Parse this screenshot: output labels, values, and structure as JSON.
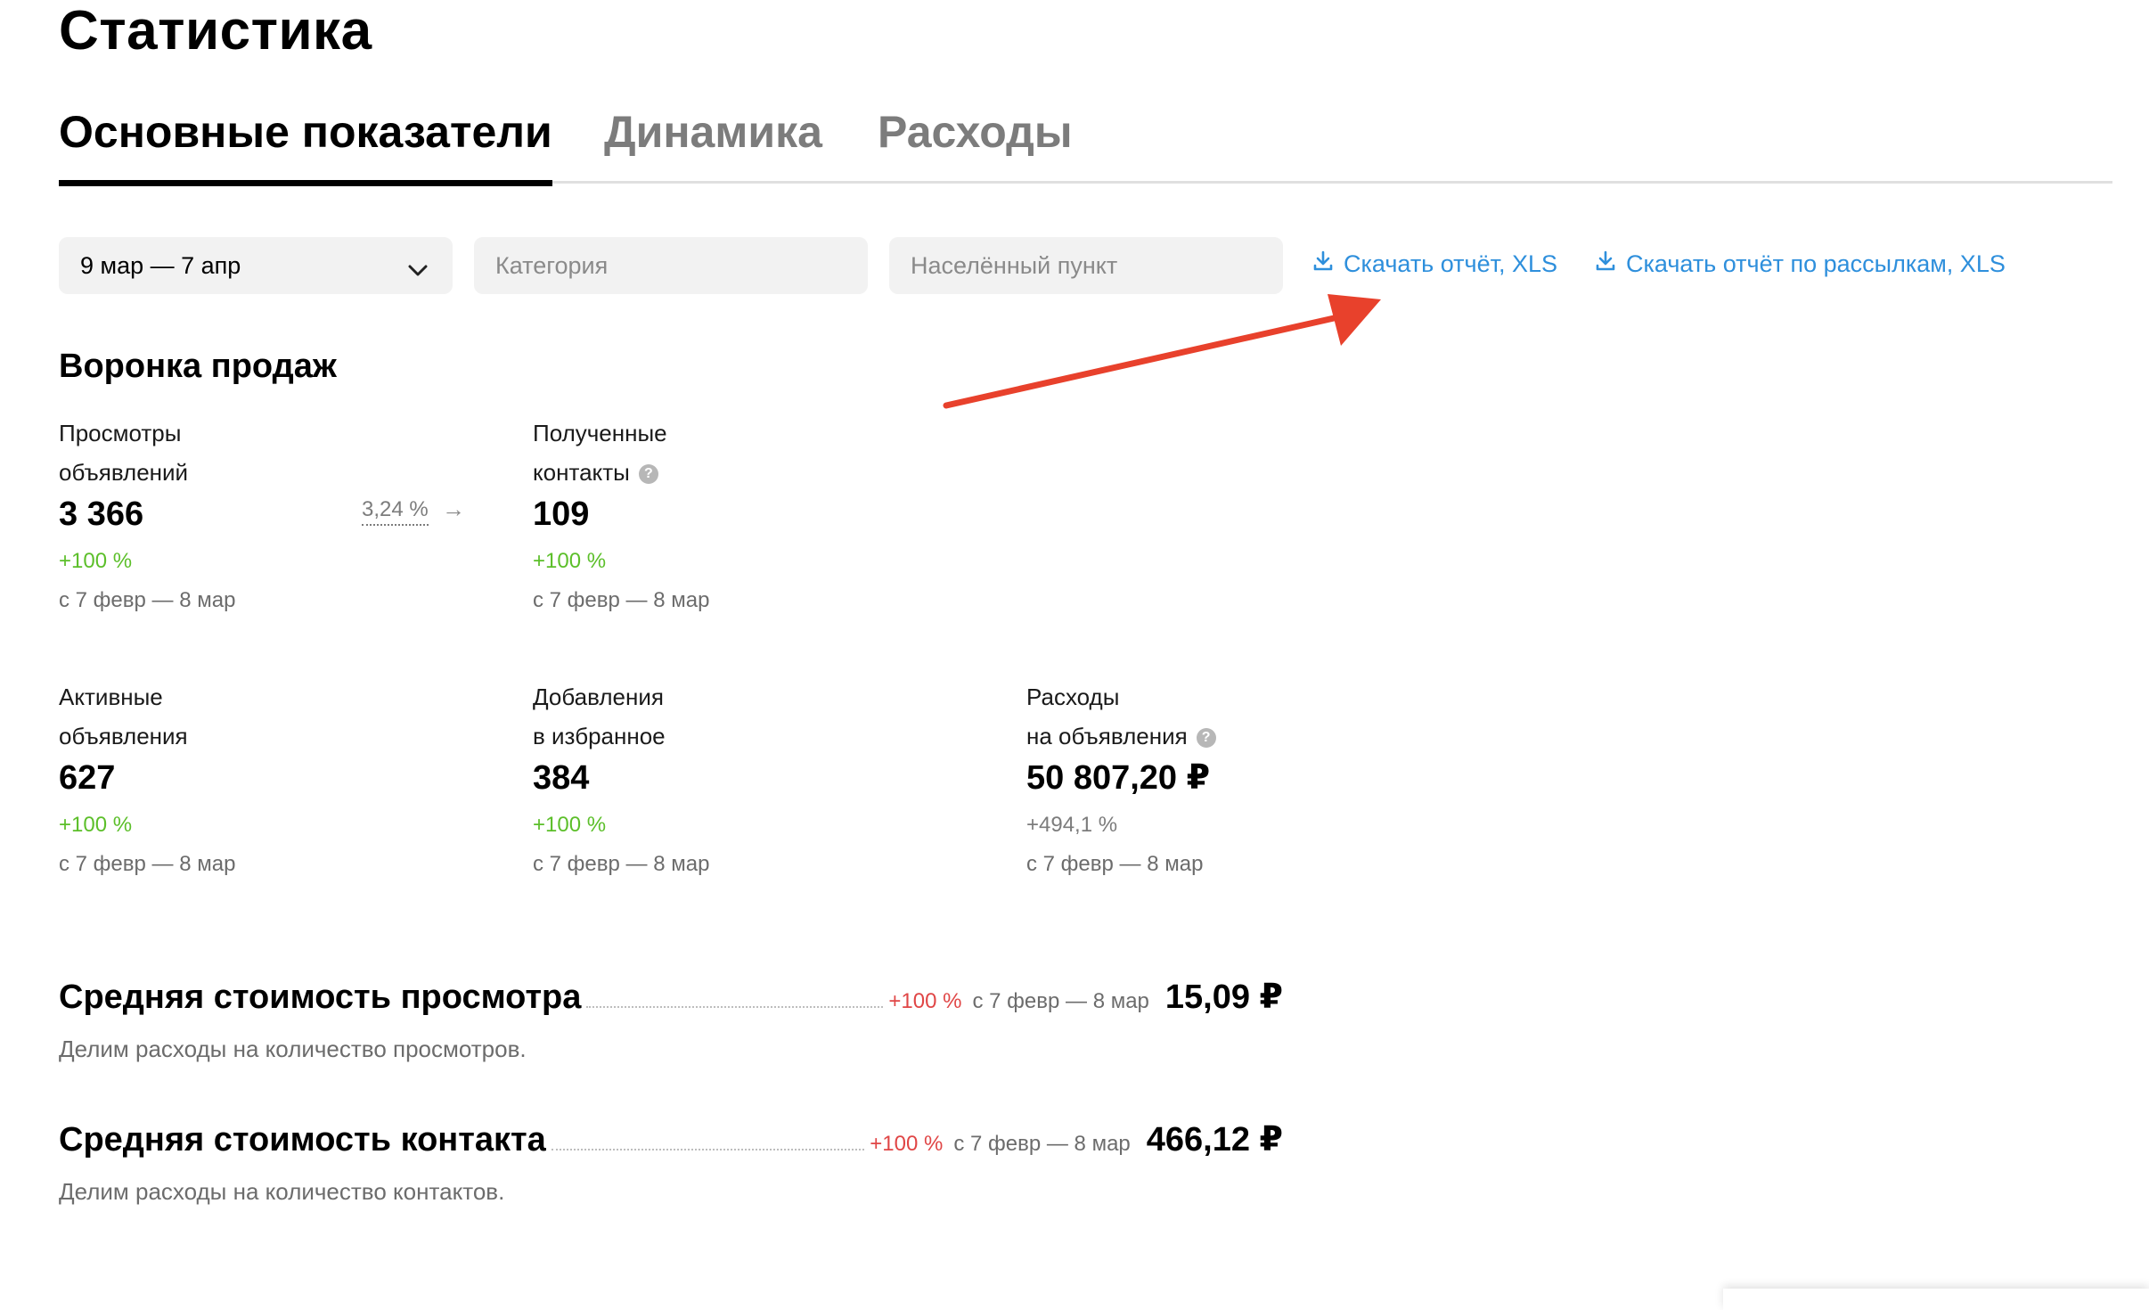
{
  "page": {
    "title": "Статистика"
  },
  "tabs": [
    {
      "label": "Основные показатели",
      "active": true
    },
    {
      "label": "Динамика",
      "active": false
    },
    {
      "label": "Расходы",
      "active": false
    }
  ],
  "filters": {
    "date_range": {
      "value": "9 мар — 7 апр",
      "icon": "chevron-down-icon"
    },
    "category": {
      "placeholder": "Категория"
    },
    "location": {
      "placeholder": "Населённый пункт"
    }
  },
  "downloads": [
    {
      "label": "Скачать отчёт, XLS",
      "icon": "download-icon"
    },
    {
      "label": "Скачать отчёт по рассылкам, XLS",
      "icon": "download-icon"
    }
  ],
  "funnel": {
    "title": "Воронка продаж",
    "conversion": "3,24 %",
    "metrics": [
      {
        "label_line1": "Просмотры",
        "label_line2": "объявлений",
        "value": "3 366",
        "change": "+100 %",
        "period": "с 7 февр — 8 мар"
      },
      {
        "label_line1": "Полученные",
        "label_line2": "контакты",
        "value": "109",
        "change": "+100 %",
        "period": "с 7 февр — 8 мар"
      },
      {
        "label_line1": "Активные",
        "label_line2": "объявления",
        "value": "627",
        "change": "+100 %",
        "period": "с 7 февр — 8 мар"
      },
      {
        "label_line1": "Добавления",
        "label_line2": "в избранное",
        "value": "384",
        "change": "+100 %",
        "period": "с 7 февр — 8 мар"
      },
      {
        "label_line1": "Расходы",
        "label_line2": "на объявления",
        "value": "50 807,20 ₽",
        "change": "+494,1 %",
        "period": "с 7 февр — 8 мар"
      }
    ]
  },
  "costs": [
    {
      "title": "Средняя стоимость просмотра",
      "change": "+100 %",
      "period": "с 7 февр — 8 мар",
      "value": "15,09 ₽",
      "description": "Делим расходы на количество просмотров."
    },
    {
      "title": "Средняя стоимость контакта",
      "change": "+100 %",
      "period": "с 7 февр — 8 мар",
      "value": "466,12 ₽",
      "description": "Делим расходы на количество контактов."
    }
  ],
  "colors": {
    "link": "#2e8fdc",
    "positive": "#5cbf2a",
    "negative": "#e04646",
    "annotation_arrow": "#e8412c"
  }
}
